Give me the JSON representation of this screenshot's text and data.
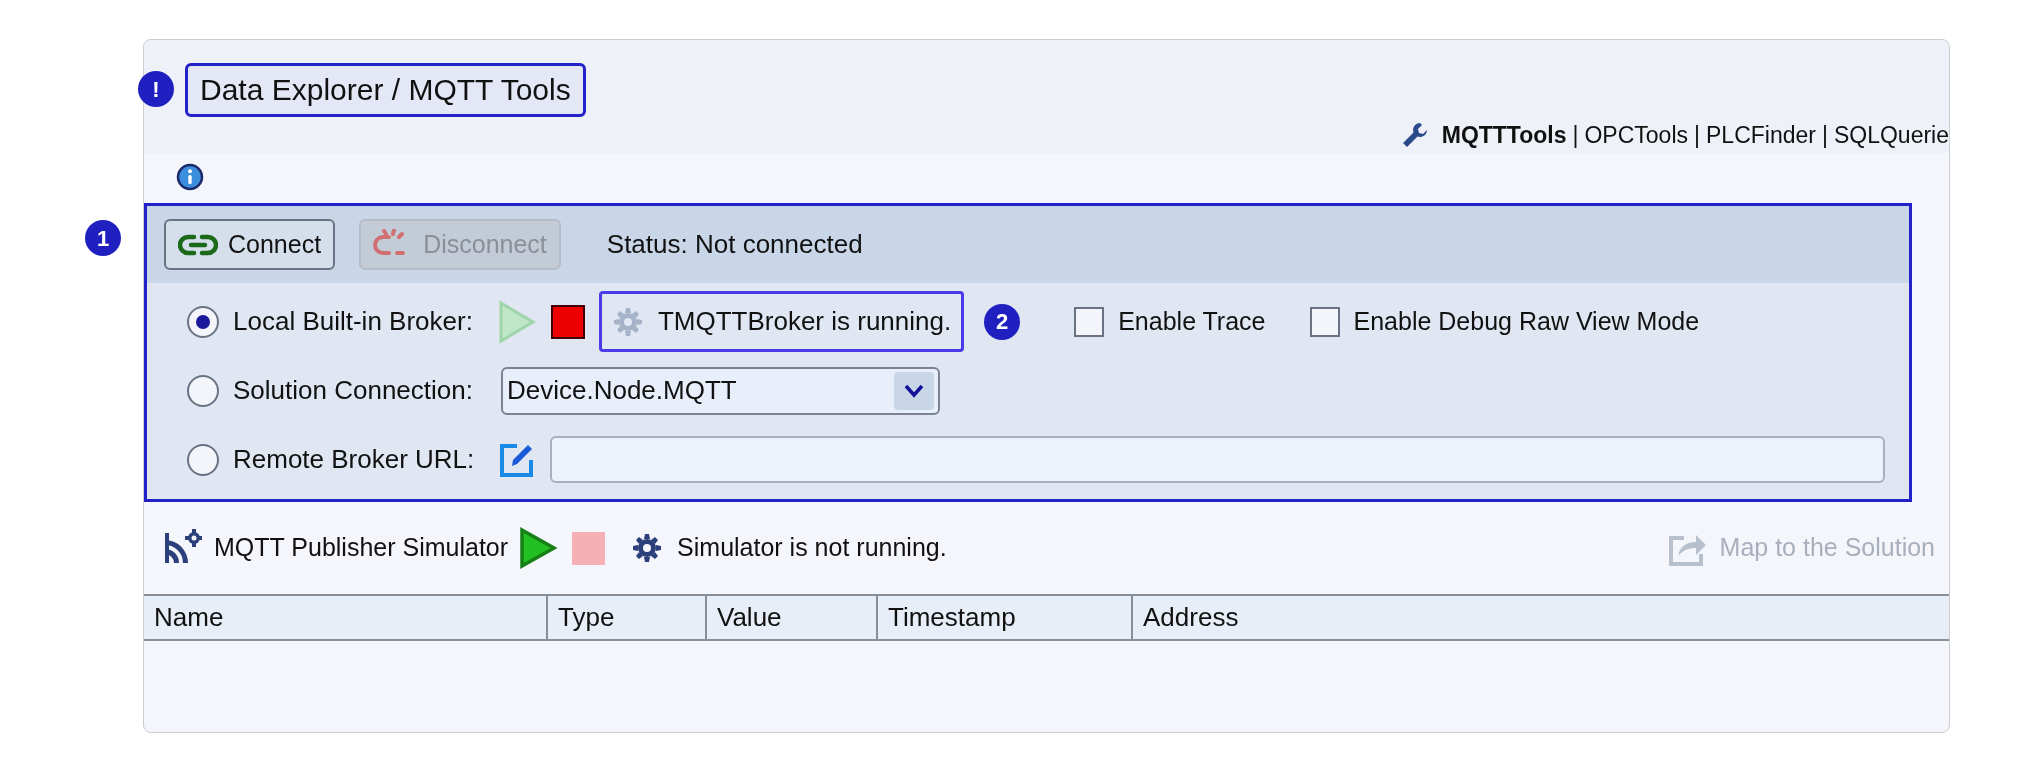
{
  "header": {
    "title": "Data Explorer / MQTT Tools",
    "title_marker": "!",
    "separator": "|",
    "tool_links": [
      {
        "label": "MQTTTools",
        "selected": true
      },
      {
        "label": "OPCTools",
        "selected": false
      },
      {
        "label": "PLCFinder",
        "selected": false
      },
      {
        "label": "SQLQuerie",
        "selected": false
      }
    ]
  },
  "connection": {
    "marker": "1",
    "buttons": [
      {
        "kind": "connect",
        "label": "Connect",
        "disabled": false
      },
      {
        "kind": "disconnect",
        "label": "Disconnect",
        "disabled": true
      }
    ],
    "status": "Status: Not connected",
    "options": [
      {
        "kind": "local",
        "label": "Local Built-in Broker:",
        "selected": true,
        "running": true,
        "status": "TMQTTBroker is running.",
        "marker": "2",
        "checkboxes": [
          {
            "label": "Enable Trace",
            "checked": false
          },
          {
            "label": "Enable Debug Raw View Mode",
            "checked": false
          }
        ]
      },
      {
        "kind": "solution",
        "label": "Solution Connection:",
        "selected": false,
        "value": "Device.Node.MQTT"
      },
      {
        "kind": "remote",
        "label": "Remote Broker URL:",
        "selected": false
      }
    ]
  },
  "simulator": {
    "label": "MQTT Publisher Simulator",
    "running": false,
    "status": "Simulator is not running.",
    "map_button": {
      "label": "Map to the Solution",
      "disabled": true
    }
  },
  "table": {
    "columns": [
      "Name",
      "Type",
      "Value",
      "Timestamp",
      "Address"
    ]
  }
}
